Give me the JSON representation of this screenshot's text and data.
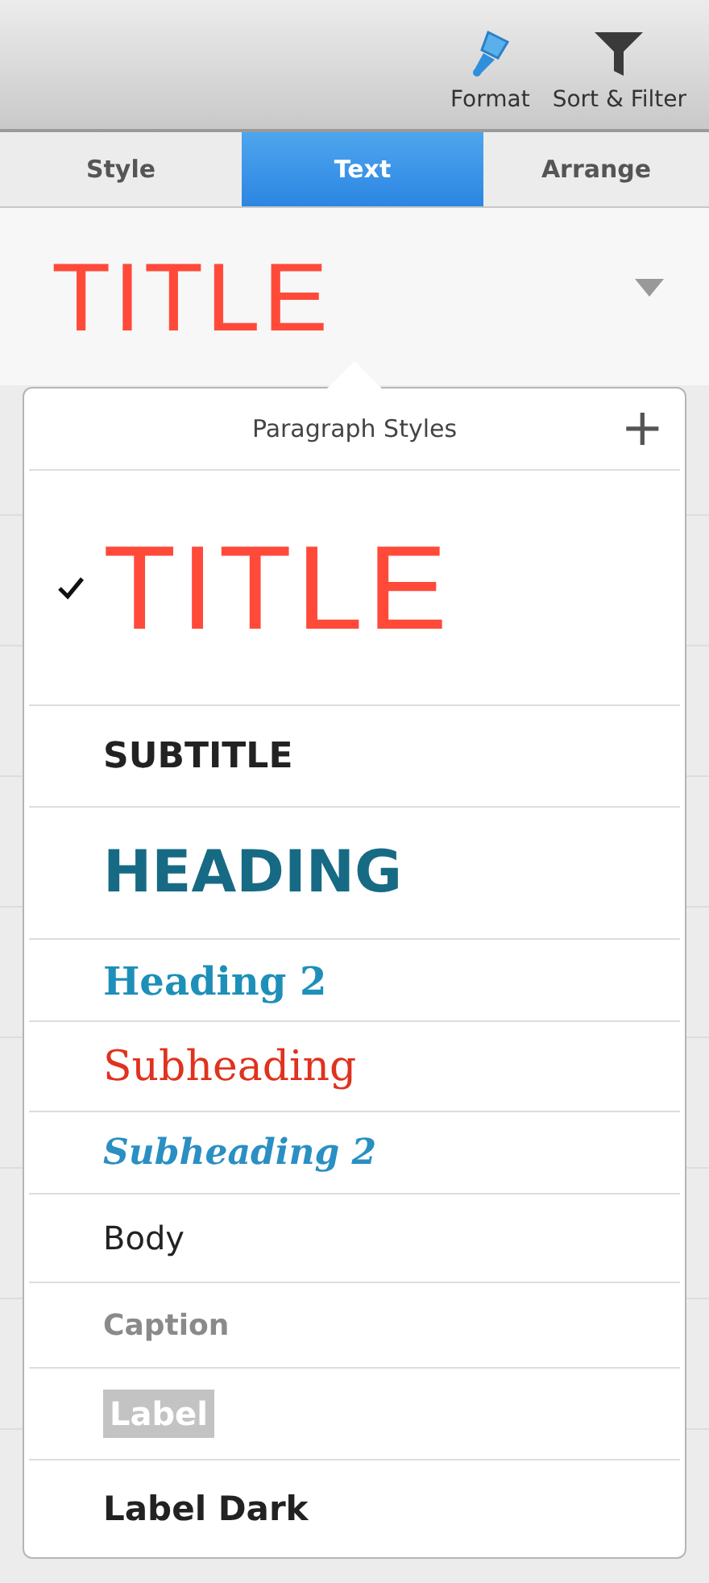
{
  "toolbar": {
    "buttons": [
      {
        "label": "Format",
        "kind": "format"
      },
      {
        "label": "Sort & Filter",
        "kind": "filter"
      }
    ]
  },
  "tabs": [
    {
      "label": "Style",
      "selected": false
    },
    {
      "label": "Text",
      "selected": true
    },
    {
      "label": "Arrange",
      "selected": false
    }
  ],
  "current_style": {
    "label": "TITLE"
  },
  "popover": {
    "title": "Paragraph Styles",
    "add_button": "+",
    "styles": [
      {
        "label": "TITLE",
        "kind": "title",
        "selected": true
      },
      {
        "label": "SUBTITLE",
        "kind": "subtitle",
        "selected": false
      },
      {
        "label": "HEADING",
        "kind": "heading",
        "selected": false
      },
      {
        "label": "Heading 2",
        "kind": "heading2",
        "selected": false
      },
      {
        "label": "Subheading",
        "kind": "subheading",
        "selected": false
      },
      {
        "label": "Subheading 2",
        "kind": "subheading2",
        "selected": false
      },
      {
        "label": "Body",
        "kind": "body",
        "selected": false
      },
      {
        "label": "Caption",
        "kind": "caption",
        "selected": false
      },
      {
        "label": "Label",
        "kind": "label",
        "selected": false
      },
      {
        "label": "Label Dark",
        "kind": "label_dark",
        "selected": false
      }
    ]
  }
}
